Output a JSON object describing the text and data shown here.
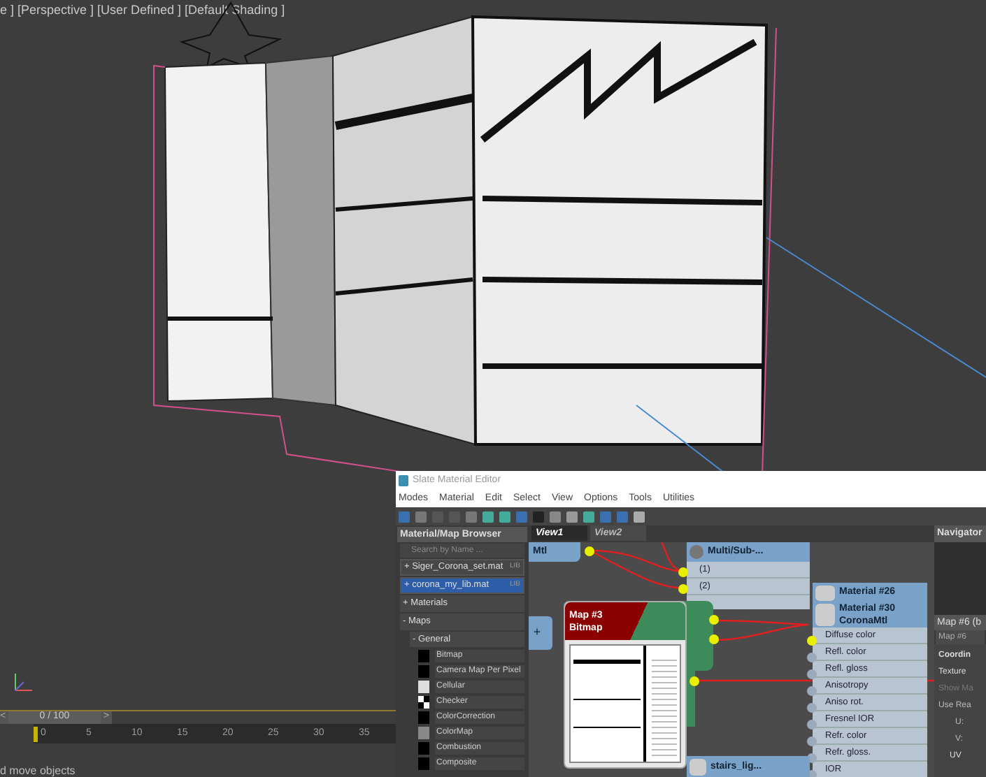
{
  "viewport": {
    "label": "e ] [Perspective ] [User Defined ] [Default Shading ]"
  },
  "timeline": {
    "prev": "<",
    "frame": "0 / 100",
    "next": ">",
    "ticks": [
      "0",
      "5",
      "10",
      "15",
      "20",
      "25",
      "30",
      "35"
    ]
  },
  "status_text": "d move objects",
  "editor": {
    "title": "Slate Material Editor",
    "menu": [
      "Modes",
      "Material",
      "Edit",
      "Select",
      "View",
      "Options",
      "Tools",
      "Utilities"
    ],
    "browser": {
      "title": "Material/Map Browser",
      "search": {
        "placeholder": "Search by Name ..."
      },
      "libraries": [
        {
          "label": "+ Siger_Corona_set.mat",
          "badge": "LIB",
          "selected": false
        },
        {
          "label": "+ corona_my_lib.mat",
          "badge": "LIB",
          "selected": true
        }
      ],
      "groups": [
        {
          "label": "+ Materials"
        },
        {
          "label": "- Maps"
        }
      ],
      "subgroup": "- General",
      "maps": [
        {
          "label": "Bitmap",
          "kind": "black"
        },
        {
          "label": "Camera Map Per Pixel",
          "kind": "black"
        },
        {
          "label": "Cellular",
          "kind": "cellular"
        },
        {
          "label": "Checker",
          "kind": "checker"
        },
        {
          "label": "ColorCorrection",
          "kind": "black"
        },
        {
          "label": "ColorMap",
          "kind": "grey"
        },
        {
          "label": "Combustion",
          "kind": "black"
        },
        {
          "label": "Composite",
          "kind": "black"
        }
      ]
    },
    "tabs": [
      {
        "label": "View1",
        "selected": true
      },
      {
        "label": "View2",
        "selected": false
      }
    ],
    "nodes": {
      "mtl": "Mtl",
      "expand": "+",
      "multi": {
        "title": "Multi/Sub-...",
        "slots": [
          {
            "label": "(1)",
            "connected": true
          },
          {
            "label": "(2)",
            "connected": true
          }
        ]
      },
      "map": {
        "name": "Map #3",
        "type": "Bitmap"
      },
      "material_26": "Material #26",
      "material_30": {
        "name": "Material #30",
        "type": "CoronaMtl",
        "slots": [
          {
            "label": "Diffuse color",
            "connected": true
          },
          {
            "label": "Refl. color",
            "connected": false
          },
          {
            "label": "Refl. gloss",
            "connected": false
          },
          {
            "label": "Anisotropy",
            "connected": false
          },
          {
            "label": "Aniso rot.",
            "connected": false
          },
          {
            "label": "Fresnel IOR",
            "connected": false
          },
          {
            "label": "Refr. color",
            "connected": false
          },
          {
            "label": "Refr. gloss.",
            "connected": false
          },
          {
            "label": "IOR",
            "connected": false
          }
        ]
      },
      "stairs": "stairs_lig..."
    },
    "navigator": "Navigator",
    "params": {
      "title": "Map #6 (b",
      "name": "Map #6",
      "rollout": "Coordin",
      "texture": "Texture",
      "show_map": "Show Ma",
      "use_real": "Use Rea",
      "u": "U:",
      "v": "V:",
      "uv": "UV"
    }
  }
}
